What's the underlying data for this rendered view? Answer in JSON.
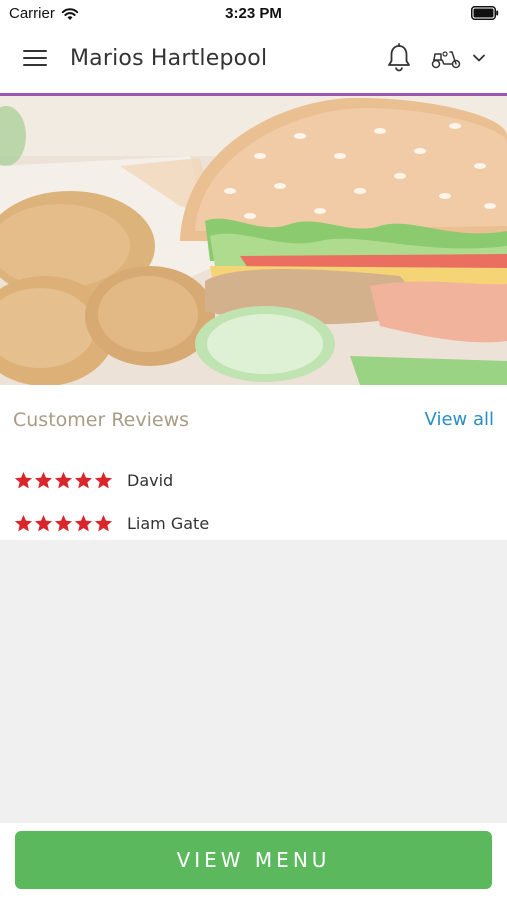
{
  "status_bar": {
    "carrier": "Carrier",
    "time": "3:23 PM"
  },
  "header": {
    "title": "Marios Hartlepool",
    "icons": [
      "menu-icon",
      "bell-icon",
      "scooter-icon",
      "chevron-down-icon"
    ],
    "accent_color": "#9b59b6"
  },
  "hero": {
    "image": "burger-and-nuggets-photo"
  },
  "reviews": {
    "heading": "Customer Reviews",
    "view_all_label": "View all",
    "star_color": "#d9262b",
    "items": [
      {
        "name": "David",
        "rating": 5
      },
      {
        "name": "Liam Gate",
        "rating": 5
      }
    ]
  },
  "footer": {
    "button_label": "VIEW MENU",
    "button_color": "#5cb85c"
  }
}
